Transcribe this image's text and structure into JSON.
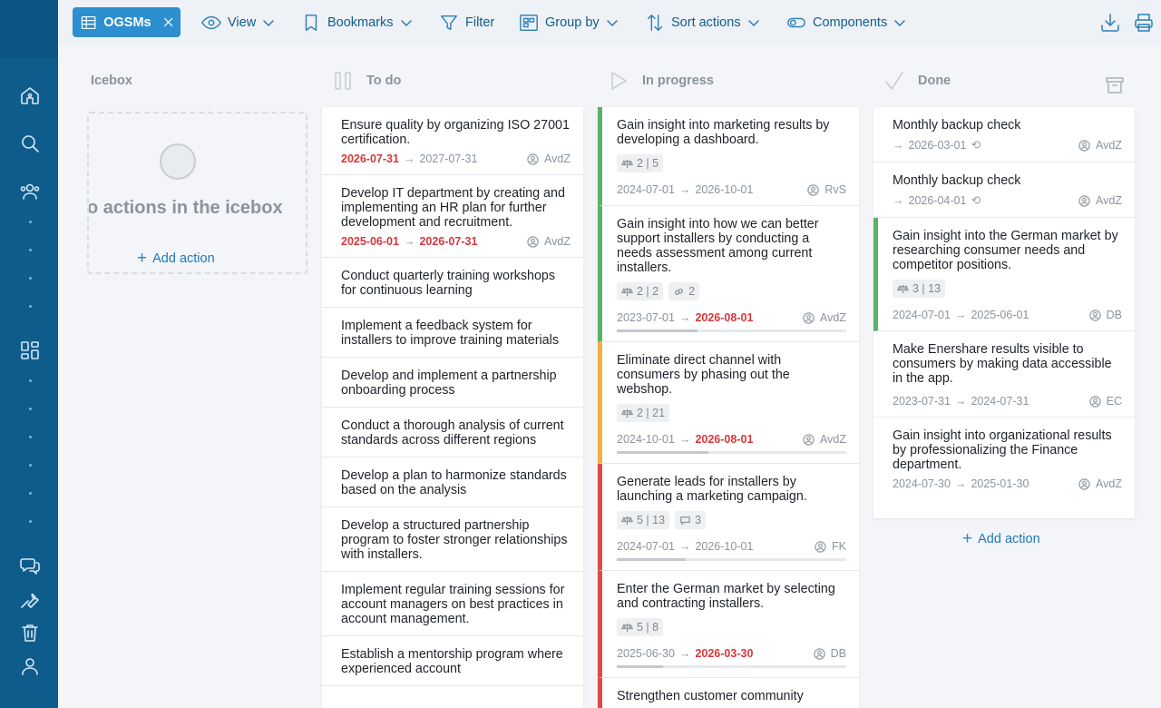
{
  "toolbar": {
    "ogsms": "OGSMs",
    "view": "View",
    "bookmarks": "Bookmarks",
    "filter": "Filter",
    "group_by": "Group by",
    "sort_actions": "Sort actions",
    "components": "Components"
  },
  "columns": {
    "icebox": "Icebox",
    "todo": "To do",
    "in_progress": "In progress",
    "done": "Done"
  },
  "icebox": {
    "empty_text": "o actions in the icebox",
    "add_action": "Add action"
  },
  "todo_cards": [
    {
      "title": "Ensure quality by organizing ISO 27001 certification.",
      "start": "2026-07-31",
      "end": "2027-07-31",
      "owner": "AvdZ"
    },
    {
      "title": "Develop IT department by creating and implementing an HR plan for further development and recruitment.",
      "start": "2025-06-01",
      "end": "2026-07-31",
      "owner": "AvdZ"
    },
    {
      "title": "Conduct quarterly training workshops for continuous learning"
    },
    {
      "title": "Implement a feedback system for installers to improve training materials"
    },
    {
      "title": "Develop and implement a partnership onboarding process"
    },
    {
      "title": "Conduct a thorough analysis of current standards across different regions"
    },
    {
      "title": "Develop a plan to harmonize standards based on the analysis"
    },
    {
      "title": "Develop a structured partnership program to foster stronger relationships with installers."
    },
    {
      "title": "Implement regular training sessions for account managers on best practices in account management."
    },
    {
      "title": "Establish a mentorship program where experienced account"
    }
  ],
  "progress_cards": [
    {
      "title": "Gain insight into marketing results by developing a dashboard.",
      "badges": [
        "2 | 5"
      ],
      "start": "2024-07-01",
      "end": "2026-10-01",
      "owner": "RvS",
      "progress": 0
    },
    {
      "title": "Gain insight into how we can better support installers by conducting a needs assessment among current installers.",
      "badges": [
        "2 | 2",
        "2"
      ],
      "start": "2023-07-01",
      "end": "2026-08-01",
      "owner": "AvdZ",
      "progress": 0.35
    },
    {
      "title": "Eliminate direct channel with consumers by phasing out the webshop.",
      "badges": [
        "2 | 21"
      ],
      "start": "2024-10-01",
      "end": "2026-08-01",
      "owner": "AvdZ",
      "progress": 0.4
    },
    {
      "title": "Generate leads for installers by launching a marketing campaign.",
      "badges": [
        "5 | 13",
        "3"
      ],
      "start": "2024-07-01",
      "end": "2026-10-01",
      "owner": "FK",
      "progress": 0.3
    },
    {
      "title": "Enter the German market by selecting and contracting installers.",
      "badges": [
        "5 | 8"
      ],
      "start": "2025-06-30",
      "end": "2026-03-30",
      "owner": "DB",
      "progress": 0.2
    },
    {
      "title": "Strengthen customer community"
    }
  ],
  "done_cards": [
    {
      "title": "Monthly backup check",
      "end": "2026-03-01",
      "owner": "AvdZ"
    },
    {
      "title": "Monthly backup check",
      "end": "2026-04-01",
      "owner": "AvdZ"
    },
    {
      "title": "Gain insight into the German market by researching consumer needs and competitor positions.",
      "badges": [
        "3 | 13"
      ],
      "start": "2024-07-01",
      "end": "2025-06-01",
      "owner": "DB"
    },
    {
      "title": "Make Enershare results visible to consumers by making data accessible in the app.",
      "start": "2023-07-31",
      "end": "2024-07-31",
      "owner": "EC"
    },
    {
      "title": "Gain insight into organizational results by professionalizing the Finance department.",
      "start": "2024-07-30",
      "end": "2025-01-30",
      "owner": "AvdZ"
    }
  ],
  "done_add_action": "Add action",
  "colors": {
    "sidebar": "#0d5c8c",
    "accent": "#2d8fd0",
    "late": "#d7373b",
    "green": "#58b368",
    "orange": "#f2b03d",
    "red": "#dc4a4a"
  }
}
